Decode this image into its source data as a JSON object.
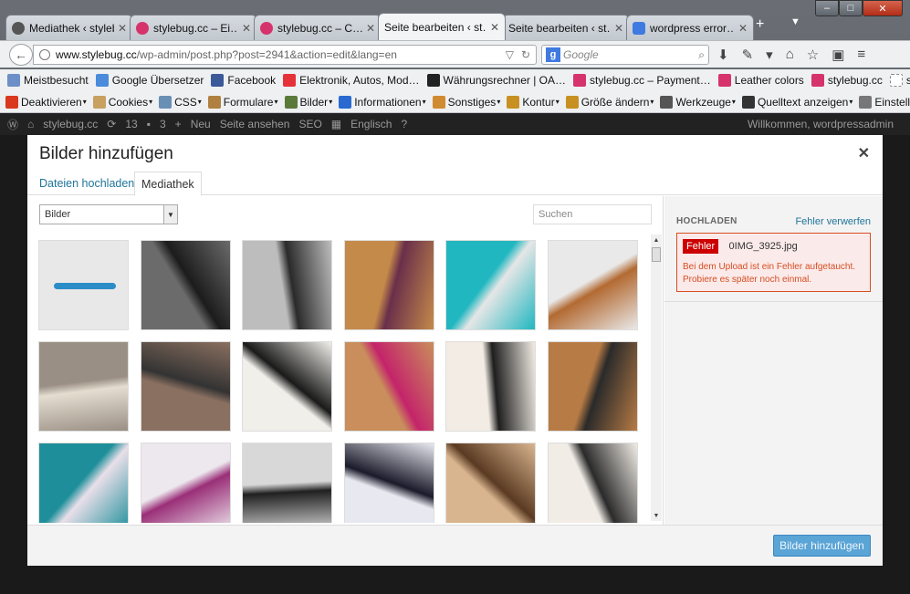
{
  "window": {
    "min": "–",
    "max": "□",
    "close": "✕"
  },
  "tabs": [
    {
      "title": "Mediathek ‹ stylebug.cc",
      "icon": "wordpress-icon"
    },
    {
      "title": "stylebug.cc – Ei…",
      "icon": "stylebug-icon"
    },
    {
      "title": "stylebug.cc – C…",
      "icon": "stylebug-icon"
    },
    {
      "title": "Seite bearbeiten ‹ st…",
      "icon": "none",
      "active": true
    },
    {
      "title": "Seite bearbeiten ‹ st…",
      "icon": "none"
    },
    {
      "title": "wordpress error…",
      "icon": "google-icon"
    }
  ],
  "tab_plus": "+",
  "tab_dropdown": "▼",
  "url": {
    "domain": "www.stylebug.cc",
    "path": "/wp-admin/post.php?post=2941&action=edit&lang=en"
  },
  "search": {
    "engine_glyph": "g",
    "placeholder": "Google"
  },
  "bookmarks": [
    {
      "label": "Meistbesucht",
      "color": "#6d8fc7"
    },
    {
      "label": "Google Übersetzer",
      "color": "#4a8bdc"
    },
    {
      "label": "Facebook",
      "color": "#3b5998"
    },
    {
      "label": "Elektronik, Autos, Mod…",
      "color": "#e53238"
    },
    {
      "label": "Währungsrechner | OA…",
      "color": "#222222"
    },
    {
      "label": "stylebug.cc – Payment…",
      "color": "#d6336c"
    },
    {
      "label": "Leather colors",
      "color": "#d6336c"
    },
    {
      "label": "stylebug.cc",
      "color": "#d6336c"
    },
    {
      "label": "stylebug admin",
      "color": "#ffffff"
    }
  ],
  "webdev": [
    {
      "label": "Deaktivieren",
      "color": "#d9381e"
    },
    {
      "label": "Cookies",
      "color": "#c8a060"
    },
    {
      "label": "CSS",
      "color": "#6a8fb5"
    },
    {
      "label": "Formulare",
      "color": "#b08040"
    },
    {
      "label": "Bilder",
      "color": "#5a7a3a"
    },
    {
      "label": "Informationen",
      "color": "#2a6ad0"
    },
    {
      "label": "Sonstiges",
      "color": "#d08a30"
    },
    {
      "label": "Kontur",
      "color": "#c89020"
    },
    {
      "label": "Größe ändern",
      "color": "#c89020"
    },
    {
      "label": "Werkzeuge",
      "color": "#555555"
    },
    {
      "label": "Quelltext anzeigen",
      "color": "#333333"
    },
    {
      "label": "Einstellungen",
      "color": "#777777"
    }
  ],
  "wpbar": {
    "site": "stylebug.cc",
    "updates": "13",
    "comments": "3",
    "new": "Neu",
    "view": "Seite ansehen",
    "seo": "SEO",
    "lang": "Englisch",
    "welcome": "Willkommen, wordpressadmin"
  },
  "modal": {
    "title": "Bilder hinzufügen",
    "close": "✕",
    "tab_upload": "Dateien hochladen",
    "tab_library": "Mediathek",
    "filter_value": "Bilder",
    "search_placeholder": "Suchen",
    "upload_heading": "HOCHLADEN",
    "dismiss": "Fehler verwerfen",
    "error_badge": "Fehler",
    "error_file": "0IMG_3925.jpg",
    "error_msg": "Bei dem Upload ist ein Fehler aufgetaucht. Probiere es später noch einmal.",
    "submit": "Bilder hinzufügen"
  },
  "thumbs": [
    {
      "bg": "#e8e8e8",
      "kind": "bar"
    },
    {
      "bg": "#6b6b6b",
      "kind": "photo",
      "c2": "#1c1c1c"
    },
    {
      "bg": "#bdbdbd",
      "kind": "photo",
      "c2": "#2a2a2a"
    },
    {
      "bg": "#c48a4a",
      "kind": "photo",
      "c2": "#6a2f4a"
    },
    {
      "bg": "#20b7c0",
      "kind": "photo",
      "c2": "#e6e6e6"
    },
    {
      "bg": "#e9e9e9",
      "kind": "photo",
      "c2": "#b36a32"
    },
    {
      "bg": "#9a8f84",
      "kind": "photo",
      "c2": "#e4ddd0"
    },
    {
      "bg": "#8a7060",
      "kind": "photo",
      "c2": "#333333"
    },
    {
      "bg": "#f0efea",
      "kind": "photo",
      "c2": "#1a1a1a"
    },
    {
      "bg": "#c98e5c",
      "kind": "photo",
      "c2": "#c4246a"
    },
    {
      "bg": "#f2ece4",
      "kind": "photo",
      "c2": "#1e1e1e"
    },
    {
      "bg": "#b77b45",
      "kind": "photo",
      "c2": "#2a2a2a"
    },
    {
      "bg": "#1e8f9a",
      "kind": "photo",
      "c2": "#e9dfe9"
    },
    {
      "bg": "#ede7ee",
      "kind": "photo",
      "c2": "#9a2f78"
    },
    {
      "bg": "#d8d8d8",
      "kind": "photo",
      "c2": "#202020"
    },
    {
      "bg": "#e8e8f0",
      "kind": "photo",
      "c2": "#1a1a2a"
    },
    {
      "bg": "#d9b58f",
      "kind": "photo",
      "c2": "#5a3a22"
    },
    {
      "bg": "#f1ece6",
      "kind": "photo",
      "c2": "#2a2a2a"
    }
  ]
}
